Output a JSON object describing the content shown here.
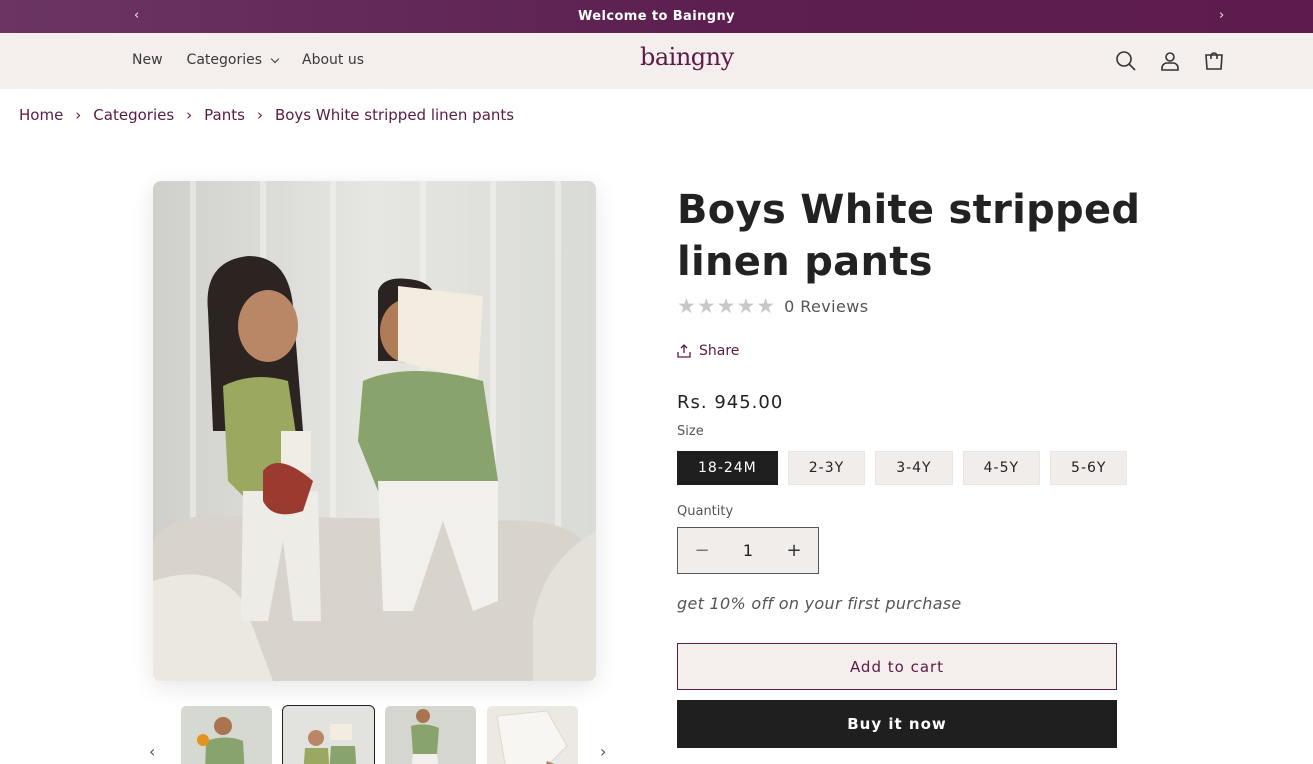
{
  "announcement": {
    "text": "Welcome to Baingny",
    "prev_arrow": "‹",
    "next_arrow": "›"
  },
  "header": {
    "logo": "baingny",
    "nav": [
      {
        "label": "New"
      },
      {
        "label": "Categories"
      },
      {
        "label": "About us"
      }
    ],
    "icons": [
      "search-icon",
      "account-icon",
      "cart-icon"
    ]
  },
  "breadcrumb": {
    "items": [
      "Home",
      "Categories",
      "Pants",
      "Boys White stripped linen pants"
    ],
    "separator": "›"
  },
  "gallery": {
    "thumbnail_count": 4,
    "active_thumbnail": 2,
    "prev_arrow": "‹",
    "next_arrow": "›"
  },
  "product": {
    "title": "Boys White stripped linen pants",
    "stars": "★★★★★",
    "rating_value": 0,
    "reviews": "0 Reviews",
    "share_label": "Share",
    "price": "Rs. 945.00",
    "size_label": "Size",
    "sizes": [
      "18-24M",
      "2-3Y",
      "3-4Y",
      "4-5Y",
      "5-6Y"
    ],
    "selected_size": "18-24M",
    "quantity_label": "Quantity",
    "quantity": "1",
    "minus": "−",
    "plus": "+",
    "promo": "get 10% off on your first purchase",
    "add_to_cart": "Add to cart",
    "buy_now": "Buy it now"
  },
  "colors": {
    "brand": "#5a1b47",
    "announcement_bg": "#5e1c4c",
    "header_bg": "#f4efec",
    "primary_button": "#1f1f1f"
  }
}
